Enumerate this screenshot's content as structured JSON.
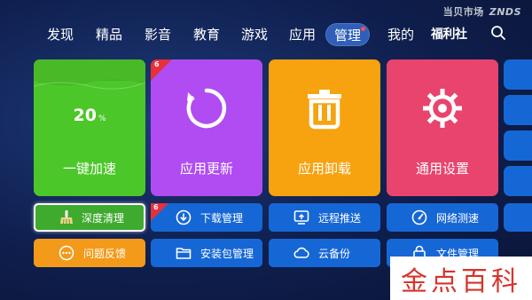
{
  "brand": {
    "left": "当贝市场",
    "right": "ZNDS"
  },
  "nav": {
    "items": [
      "发现",
      "精品",
      "影音",
      "教育",
      "游戏",
      "应用",
      "管理",
      "我的",
      "福利社"
    ],
    "active_index": 6
  },
  "tiles": {
    "speedup": {
      "percent": "20",
      "percent_unit": "%",
      "label": "一键加速"
    },
    "update": {
      "badge": "6",
      "label": "应用更新"
    },
    "uninstall": {
      "label": "应用卸载"
    },
    "settings": {
      "label": "通用设置"
    }
  },
  "buttons": {
    "deep_clean": "深度清理",
    "download_manager": {
      "label": "下载管理",
      "badge": "6"
    },
    "remote_push": "远程推送",
    "network_test": "网络测速",
    "feedback": "问题反馈",
    "package_manager": "安装包管理",
    "cloud_backup": "云备份",
    "file_manager": "文件管理"
  },
  "watermark": "金点百科",
  "colors": {
    "green": "#4cc72a",
    "purple": "#b04cf2",
    "orange": "#f7a20f",
    "pink": "#e8446e",
    "blue_button": "#1667d6",
    "badge_red": "#e8303a"
  }
}
